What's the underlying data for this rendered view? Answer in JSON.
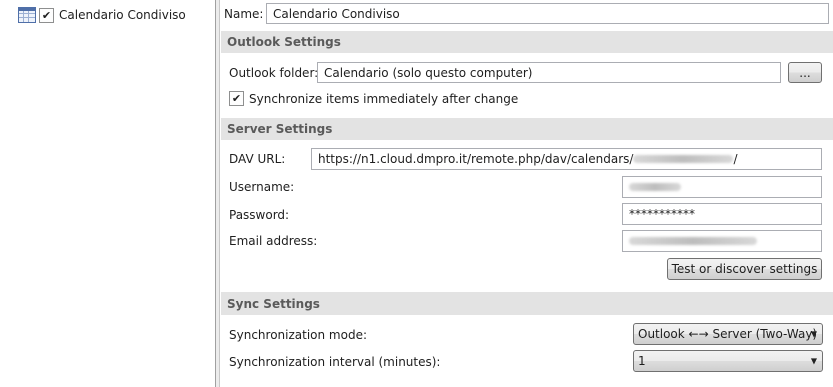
{
  "tree": {
    "items": [
      {
        "label": "Calendario Condiviso",
        "checked": true,
        "icon": "calendar-icon"
      }
    ]
  },
  "name": {
    "label": "Name:",
    "value": "Calendario Condiviso"
  },
  "outlook_settings": {
    "title": "Outlook Settings",
    "folder_label": "Outlook folder:",
    "folder_value": "Calendario (solo questo computer)",
    "browse_label": "...",
    "sync_immediately_label": "Synchronize items immediately after change",
    "sync_immediately_checked": true
  },
  "server_settings": {
    "title": "Server Settings",
    "dav_url_label": "DAV URL:",
    "dav_url_value": "https://n1.cloud.dmpro.it/remote.php/dav/calendars/",
    "dav_url_suffix": "/",
    "username_label": "Username:",
    "password_label": "Password:",
    "password_value": "***********",
    "email_label": "Email address:",
    "test_button": "Test or discover settings"
  },
  "sync_settings": {
    "title": "Sync Settings",
    "mode_label": "Synchronization mode:",
    "mode_value": "Outlook ←→ Server (Two-Way)",
    "interval_label": "Synchronization interval (minutes):",
    "interval_value": "1"
  },
  "colors": {
    "section_bg": "#e3e3e3",
    "section_text": "#5a5a5a",
    "border": "#abadb3"
  }
}
